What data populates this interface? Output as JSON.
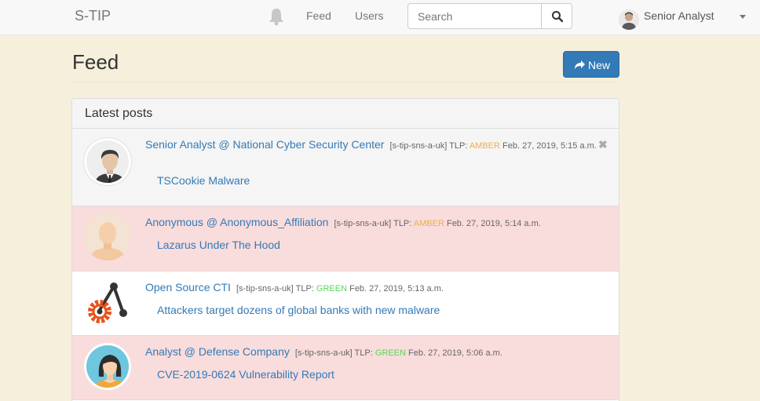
{
  "navbar": {
    "brand": "S-TIP",
    "feed_label": "Feed",
    "users_label": "Users",
    "search_placeholder": "Search",
    "user_name": "Senior Analyst"
  },
  "page": {
    "title": "Feed",
    "new_label": "New"
  },
  "panel": {
    "heading": "Latest posts"
  },
  "posts": [
    {
      "author": "Senior Analyst @ National Cyber Security Center",
      "tag": "[s-tip-sns-a-uk]",
      "tlp_label": "TLP:",
      "tlp": "AMBER",
      "date": "Feb. 27, 2019, 5:15 a.m.",
      "title": "TSCookie Malware",
      "close": "✖"
    },
    {
      "author": "Anonymous @ Anonymous_Affiliation",
      "tag": "[s-tip-sns-a-uk]",
      "tlp_label": "TLP:",
      "tlp": "AMBER",
      "date": "Feb. 27, 2019, 5:14 a.m.",
      "title": "Lazarus Under The Hood"
    },
    {
      "author": "Open Source CTI",
      "tag": "[s-tip-sns-a-uk]",
      "tlp_label": "TLP:",
      "tlp": "GREEN",
      "date": "Feb. 27, 2019, 5:13 a.m.",
      "title": "Attackers target dozens of global banks with new malware"
    },
    {
      "author": "Analyst @ Defense Company",
      "tag": "[s-tip-sns-a-uk]",
      "tlp_label": "TLP:",
      "tlp": "GREEN",
      "date": "Feb. 27, 2019, 5:06 a.m.",
      "title": "CVE-2019-0624 Vulnerability Report"
    }
  ],
  "colors": {
    "background": "#f5efdc",
    "link": "#337ab7",
    "amber": "#f0ad4e",
    "green": "#5cd65c",
    "danger_row": "#f9dcdc",
    "primary_button": "#337ab7"
  },
  "icons": [
    "bell-icon",
    "search-icon",
    "share-icon",
    "close-icon",
    "chevron-down-icon"
  ]
}
